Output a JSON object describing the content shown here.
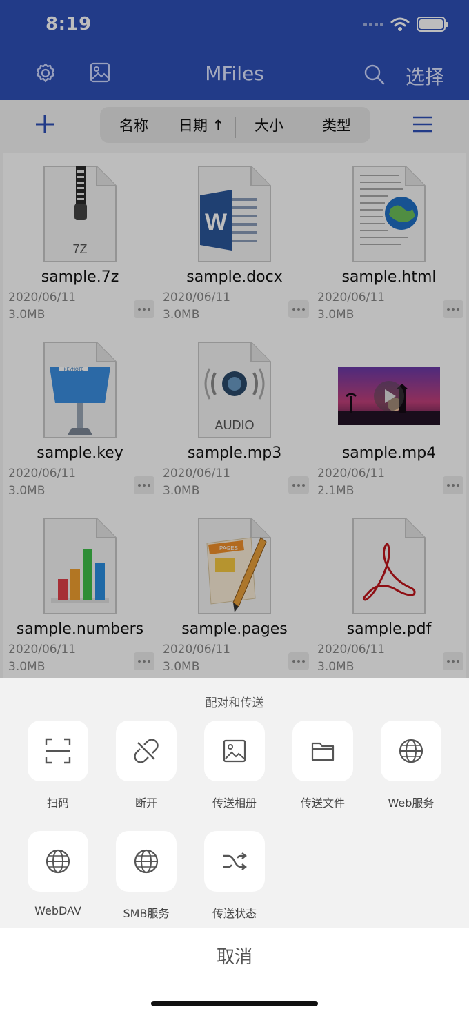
{
  "status": {
    "time": "8:19"
  },
  "header": {
    "title": "MFiles",
    "select_label": "选择"
  },
  "sort": {
    "options": [
      "名称",
      "日期 ↑",
      "大小",
      "类型"
    ]
  },
  "files": [
    {
      "name": "sample.7z",
      "date": "2020/06/11",
      "size": "3.0MB",
      "icon": "zip-icon",
      "badge": "7Z"
    },
    {
      "name": "sample.docx",
      "date": "2020/06/11",
      "size": "3.0MB",
      "icon": "word-icon",
      "badge": "W"
    },
    {
      "name": "sample.html",
      "date": "2020/06/11",
      "size": "3.0MB",
      "icon": "html-icon"
    },
    {
      "name": "sample.key",
      "date": "2020/06/11",
      "size": "3.0MB",
      "icon": "keynote-icon",
      "badge": "KEYNOTE"
    },
    {
      "name": "sample.mp3",
      "date": "2020/06/11",
      "size": "3.0MB",
      "icon": "audio-icon",
      "badge": "AUDIO"
    },
    {
      "name": "sample.mp4",
      "date": "2020/06/11",
      "size": "2.1MB",
      "icon": "video-thumbnail"
    },
    {
      "name": "sample.numbers",
      "date": "2020/06/11",
      "size": "3.0MB",
      "icon": "numbers-icon"
    },
    {
      "name": "sample.pages",
      "date": "2020/06/11",
      "size": "3.0MB",
      "icon": "pages-icon",
      "badge": "PAGES"
    },
    {
      "name": "sample.pdf",
      "date": "2020/06/11",
      "size": "3.0MB",
      "icon": "pdf-icon"
    }
  ],
  "sheet": {
    "title": "配对和传送",
    "actions": [
      {
        "label": "扫码",
        "icon": "scan-icon"
      },
      {
        "label": "断开",
        "icon": "unlink-icon"
      },
      {
        "label": "传送相册",
        "icon": "image-icon"
      },
      {
        "label": "传送文件",
        "icon": "folder-icon"
      },
      {
        "label": "Web服务",
        "icon": "globe-icon"
      },
      {
        "label": "WebDAV",
        "icon": "globe-icon"
      },
      {
        "label": "SMB服务",
        "icon": "globe-icon"
      },
      {
        "label": "传送状态",
        "icon": "shuffle-icon"
      }
    ],
    "cancel_label": "取消"
  },
  "colors": {
    "header_bg": "#2f50b8",
    "accent": "#2f50b8",
    "pdf_red": "#c0151b"
  }
}
